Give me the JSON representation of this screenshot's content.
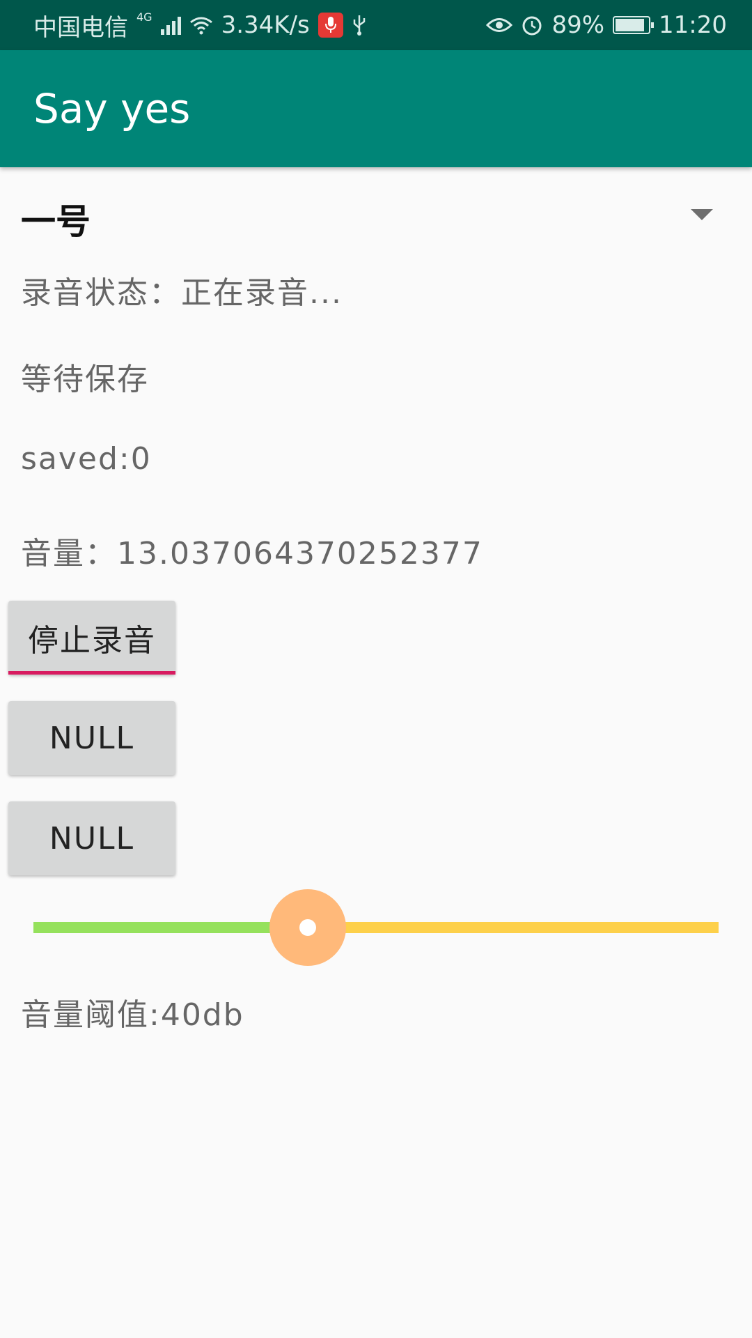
{
  "status_bar": {
    "carrier": "中国电信",
    "network_type": "4G",
    "speed": "3.34K/s",
    "battery": "89%",
    "time": "11:20",
    "icons": [
      "signal-icon",
      "wifi-icon",
      "microphone-icon",
      "usb-icon",
      "eye-icon",
      "alarm-icon",
      "battery-icon"
    ]
  },
  "app_bar": {
    "title": "Say yes"
  },
  "spinner": {
    "selected": "一号"
  },
  "record_status": "录音状态：正在录音...",
  "save_status": "等待保存",
  "saved": "saved:0",
  "volume": "音量：13.037064370252377",
  "buttons": {
    "stop_record": "停止录音",
    "null_1": "NULL",
    "null_2": "NULL"
  },
  "slider": {
    "value_fraction": 0.4,
    "colors": {
      "progress": "#95e15c",
      "track": "#fdd04a",
      "thumb": "#ffb97a"
    }
  },
  "threshold": "音量阈值:40db",
  "colors": {
    "status_bar": "#00574b",
    "app_bar": "#008577",
    "accent": "#d81b60"
  }
}
